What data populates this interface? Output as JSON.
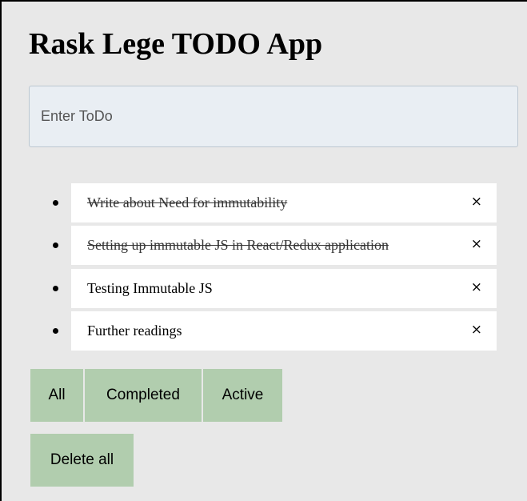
{
  "app": {
    "title": "Rask Lege TODO App"
  },
  "input": {
    "placeholder": "Enter ToDo",
    "value": ""
  },
  "todos": [
    {
      "text": "Write about Need for immutability",
      "completed": true,
      "remove_label": "×"
    },
    {
      "text": "Setting up immutable JS in React/Redux application",
      "completed": true,
      "remove_label": "×"
    },
    {
      "text": "Testing Immutable JS",
      "completed": false,
      "remove_label": "×"
    },
    {
      "text": "Further readings",
      "completed": false,
      "remove_label": "×"
    }
  ],
  "filters": {
    "all": "All",
    "completed": "Completed",
    "active": "Active"
  },
  "actions": {
    "delete_all": "Delete all"
  },
  "colors": {
    "button_bg": "#b1cdae",
    "page_bg": "#e8e8e8",
    "input_bg": "#e9eef3"
  }
}
